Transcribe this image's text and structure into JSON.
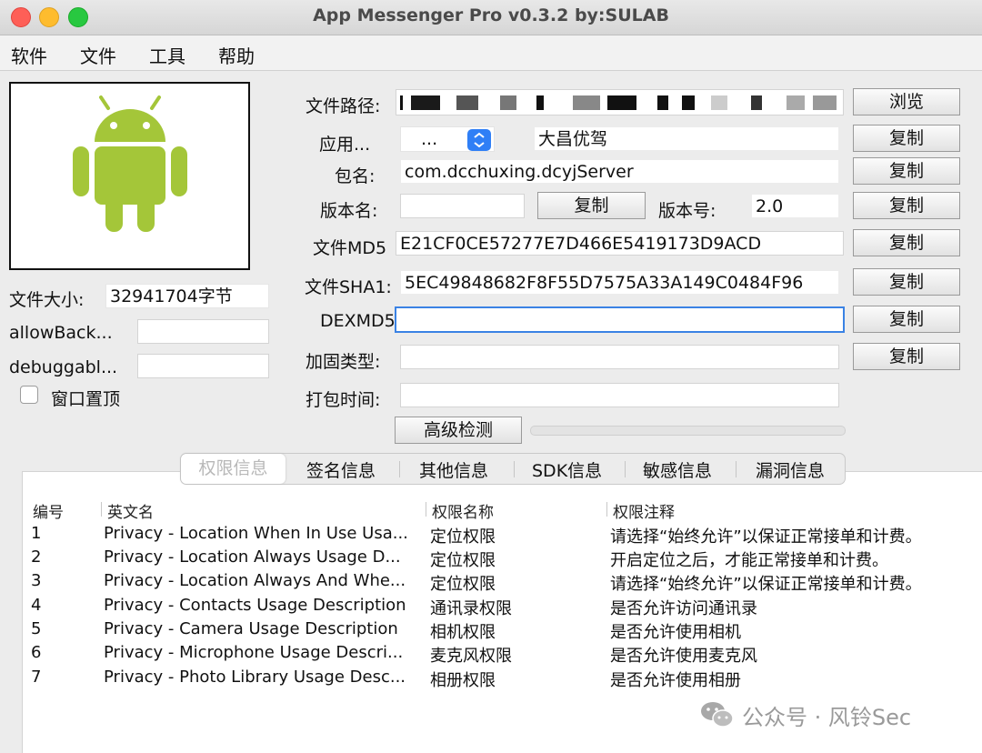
{
  "window": {
    "title": "App Messenger Pro v0.3.2   by:SULAB",
    "controls": [
      "close",
      "minimize",
      "zoom"
    ]
  },
  "menu": [
    "软件",
    "文件",
    "工具",
    "帮助"
  ],
  "app_icon": "android-robot-icon",
  "left_panel": {
    "file_size_label": "文件大小:",
    "file_size_value": "32941704字节",
    "allow_backup_label": "allowBack...",
    "allow_backup_value": "",
    "debuggable_label": "debuggabl...",
    "debuggable_value": "",
    "pin_window_label": "窗口置顶",
    "pin_window_checked": false
  },
  "fields": {
    "file_path_label": "文件路径:",
    "browse_label": "浏览",
    "app_name_label": "应用...",
    "app_selector_value": "...",
    "app_name_value": "大昌优驾",
    "package_label": "包名:",
    "package_value": "com.dcchuxing.dcyjServer",
    "version_name_label": "版本名:",
    "version_name_value": "",
    "version_code_label": "版本号:",
    "version_code_value": "2.0",
    "md5_label": "文件MD5",
    "md5_value": "E21CF0CE57277E7D466E5419173D9ACD",
    "sha1_label": "文件SHA1:",
    "sha1_value": "5EC49848682F8F55D7575A33A149C0484F96",
    "dex_md5_label": "DEXMD5",
    "dex_md5_value": "",
    "packer_label": "加固类型:",
    "packer_value": "",
    "pack_time_label": "打包时间:",
    "pack_time_value": "",
    "copy_label": "复制",
    "advanced_label": "高级检测"
  },
  "tabs": [
    "权限信息",
    "签名信息",
    "其他信息",
    "SDK信息",
    "敏感信息",
    "漏洞信息"
  ],
  "active_tab": 0,
  "table": {
    "columns": [
      "编号",
      "英文名",
      "权限名称",
      "权限注释"
    ],
    "rows": [
      [
        "1",
        "Privacy - Location When In Use Usa...",
        "定位权限",
        "请选择“始终允许”以保证正常接单和计费。"
      ],
      [
        "2",
        "Privacy - Location Always Usage D...",
        "定位权限",
        "开启定位之后，才能正常接单和计费。"
      ],
      [
        "3",
        "Privacy - Location Always And Whe...",
        "定位权限",
        "请选择“始终允许”以保证正常接单和计费。"
      ],
      [
        "4",
        "Privacy - Contacts Usage Description",
        "通讯录权限",
        "是否允许访问通讯录"
      ],
      [
        "5",
        "Privacy - Camera Usage Description",
        "相机权限",
        "是否允许使用相机"
      ],
      [
        "6",
        "Privacy - Microphone Usage Descri...",
        "麦克风权限",
        "是否允许使用麦克风"
      ],
      [
        "7",
        "Privacy - Photo Library Usage Desc...",
        "相册权限",
        "是否允许使用相册"
      ]
    ]
  },
  "watermark": "公众号 · 风铃Sec"
}
